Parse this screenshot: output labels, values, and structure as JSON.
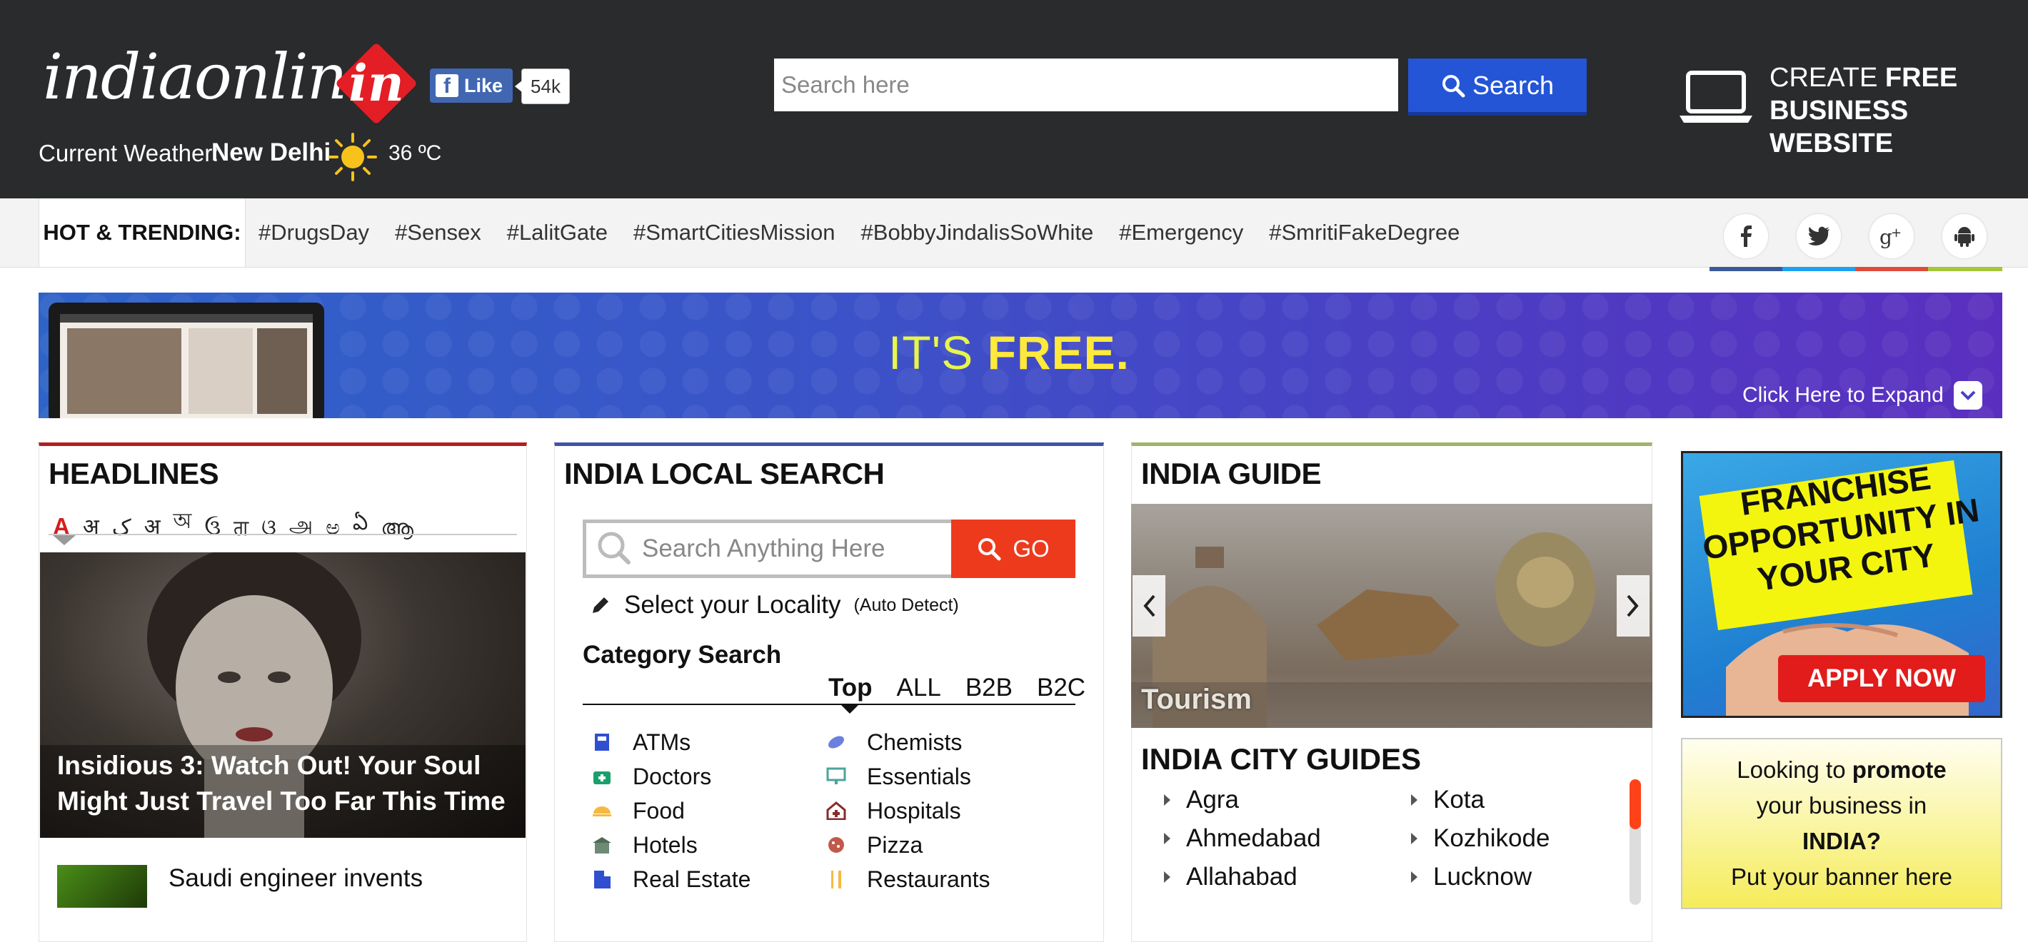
{
  "header": {
    "logo_word": "indiaonline",
    "logo_badge": "in",
    "fb_like_label": "Like",
    "fb_like_count": "54k",
    "weather_label": "Current Weather:",
    "weather_city": "New Delhi",
    "weather_icon": "sun-icon",
    "weather_temp": "36 ºC",
    "search_placeholder": "Search here",
    "search_button": "Search",
    "create_line1_a": "CREATE ",
    "create_line1_b": "FREE",
    "create_line2": "BUSINESS WEBSITE"
  },
  "trending": {
    "label": "HOT & TRENDING:",
    "tags": [
      "#DrugsDay",
      "#Sensex",
      "#LalitGate",
      "#SmartCitiesMission",
      "#BobbyJindalisSoWhite",
      "#Emergency",
      "#SmritiFakeDegree"
    ],
    "social": [
      "facebook-icon",
      "twitter-icon",
      "google-plus-icon",
      "android-icon"
    ],
    "stripe_colors": [
      "#3b5998",
      "#1da1f2",
      "#dd4b39",
      "#a4c639"
    ]
  },
  "banner": {
    "text_a": "IT'S ",
    "text_b": "FREE.",
    "expand": "Click Here to Expand"
  },
  "headlines": {
    "title": "HEADLINES",
    "languages": [
      "A",
      "अ",
      "ک",
      "अ",
      "অ",
      "ઉ",
      "ਗ",
      "ଓ",
      "அ",
      "ಅ",
      "ఏ",
      "ആ"
    ],
    "main_caption": "Insidious 3: Watch Out! Your Soul Might Just Travel Too Far This Time",
    "next_item": "Saudi engineer invents"
  },
  "local_search": {
    "title": "INDIA LOCAL SEARCH",
    "placeholder": "Search Anything Here",
    "go": "GO",
    "locality": "Select your Locality",
    "auto_detect": "(Auto Detect)",
    "category_title": "Category Search",
    "tabs": [
      "Top",
      "ALL",
      "B2B",
      "B2C"
    ],
    "left_items": [
      "ATMs",
      "Doctors",
      "Food",
      "Hotels",
      "Real Estate"
    ],
    "right_items": [
      "Chemists",
      "Essentials",
      "Hospitals",
      "Pizza",
      "Restaurants"
    ]
  },
  "guide": {
    "title": "INDIA GUIDE",
    "slide_caption": "Tourism",
    "city_title": "INDIA CITY GUIDES",
    "cities_left": [
      "Agra",
      "Ahmedabad",
      "Allahabad"
    ],
    "cities_right": [
      "Kota",
      "Kozhikode",
      "Lucknow"
    ]
  },
  "ads": {
    "franchise": "FRANCHISE OPPORTUNITY IN YOUR CITY",
    "apply": "APPLY NOW",
    "promo_1a": "Looking to ",
    "promo_1b": "promote",
    "promo_2": "your business in",
    "promo_3": "INDIA?",
    "promo_4": "Put your banner here"
  },
  "colors": {
    "header_bg": "#292b2d",
    "search_blue": "#2355d6",
    "go_orange": "#ee3a1c",
    "headlines_accent": "#b21f1f",
    "local_accent": "#4253a9",
    "guide_accent": "#9db56a"
  }
}
